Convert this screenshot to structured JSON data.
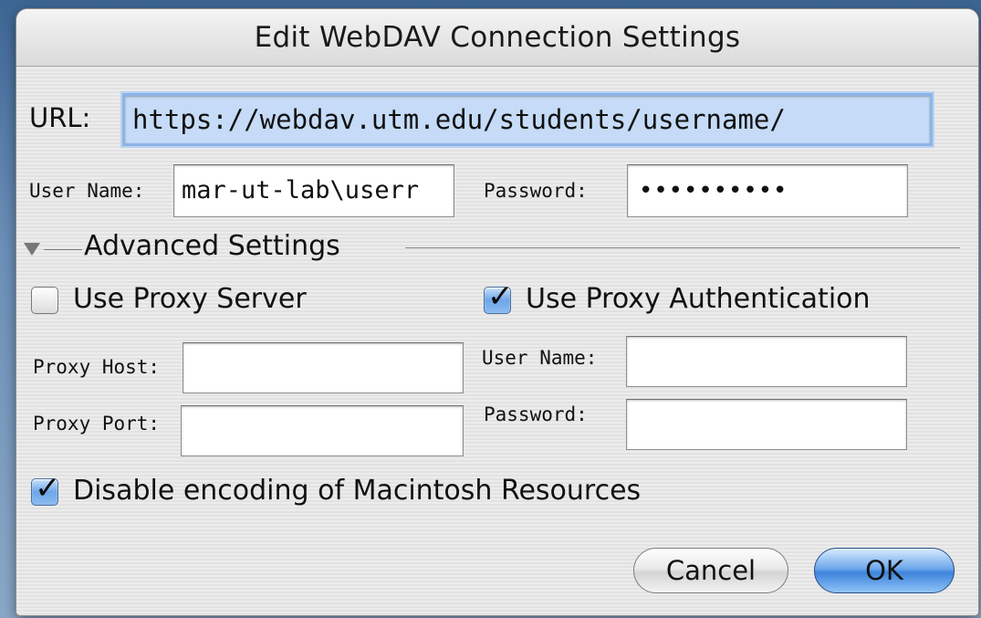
{
  "dialog": {
    "title": "Edit WebDAV Connection Settings"
  },
  "url": {
    "label": "URL:",
    "value": "https://webdav.utm.edu/students/username/"
  },
  "credentials": {
    "user_label": "User Name:",
    "user_value": "mar-ut-lab\\userr",
    "password_label": "Password:",
    "password_value": "••••••••••"
  },
  "advanced": {
    "label": "Advanced Settings",
    "use_proxy_server": {
      "label": "Use Proxy Server",
      "checked": false
    },
    "use_proxy_auth": {
      "label": "Use Proxy Authentication",
      "checked": true
    },
    "proxy_host_label": "Proxy Host:",
    "proxy_host_value": "",
    "proxy_port_label": "Proxy Port:",
    "proxy_port_value": "",
    "proxy_user_label": "User Name:",
    "proxy_user_value": "",
    "proxy_password_label": "Password:",
    "proxy_password_value": ""
  },
  "disable_encoding": {
    "label": "Disable encoding of Macintosh Resources",
    "checked": true
  },
  "buttons": {
    "cancel": "Cancel",
    "ok": "OK"
  },
  "icons": {
    "disclosure": "disclosure-triangle-down-icon",
    "check": "checkmark-icon"
  },
  "colors": {
    "url_highlight": "#c5dbf7",
    "default_button": "#3d84db"
  }
}
